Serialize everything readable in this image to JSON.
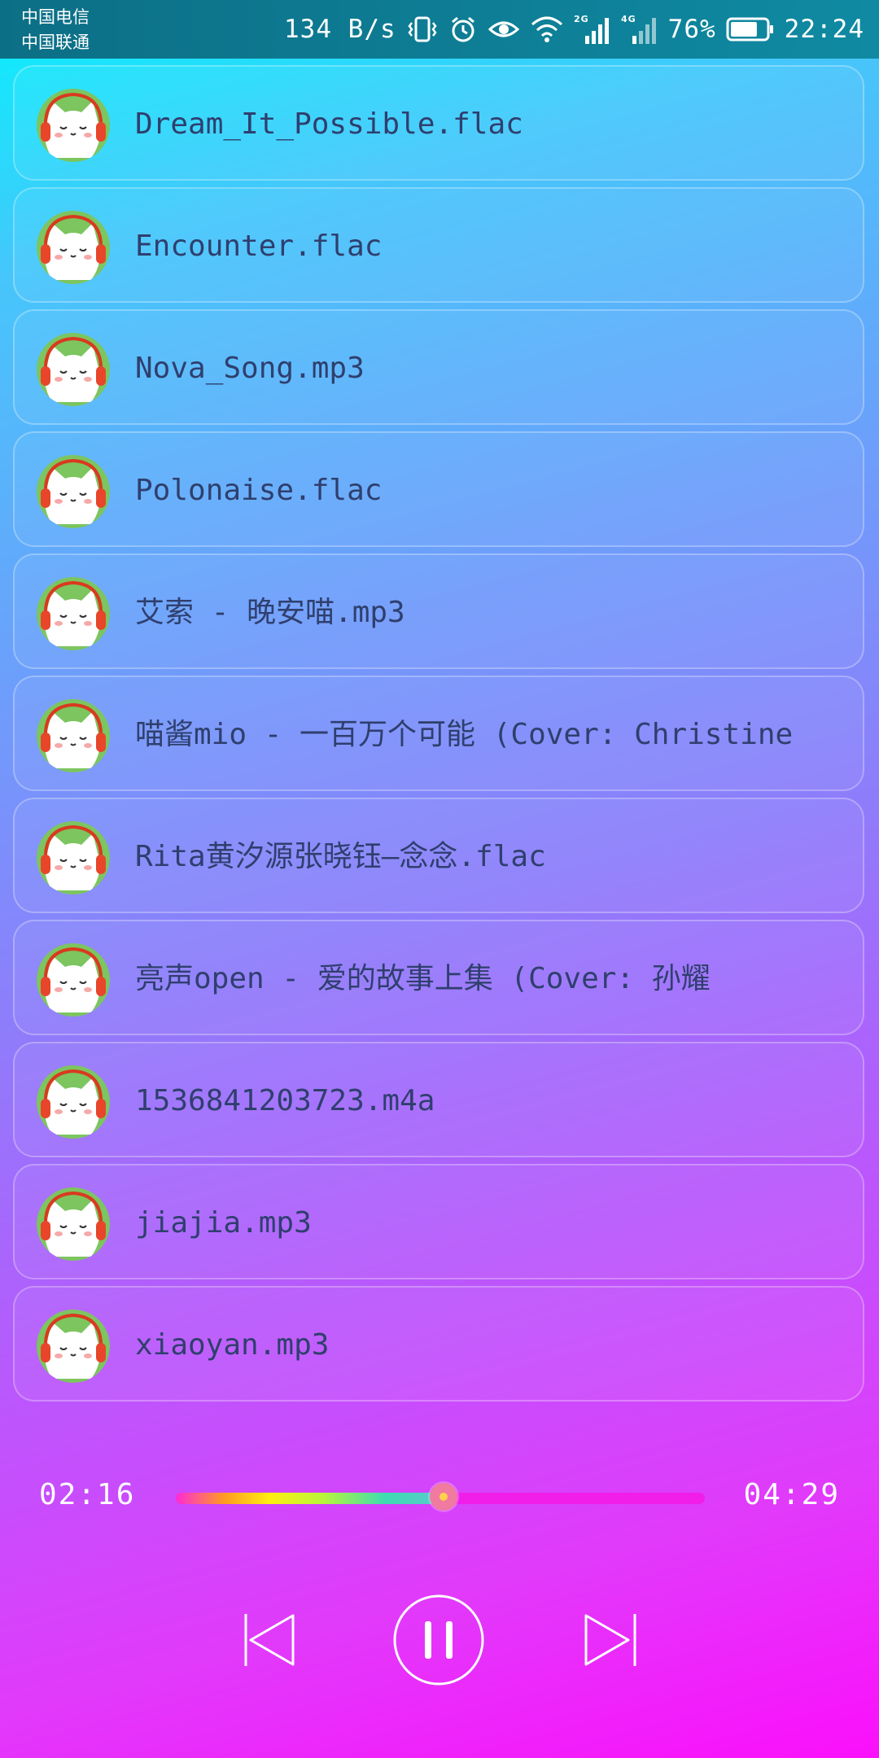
{
  "status_bar": {
    "carrier_1": "中国电信",
    "carrier_2": "中国联通",
    "net_speed": "134 B/s",
    "signal_1_label": "2G",
    "signal_2_label": "4G",
    "battery_percent": "76%",
    "battery_level": 0.76,
    "time": "22:24",
    "icons": [
      "vibrate-icon",
      "alarm-icon",
      "eye-icon",
      "wifi-icon",
      "signal-icon",
      "battery-icon"
    ]
  },
  "songs": [
    {
      "title": "Dream_It_Possible.flac"
    },
    {
      "title": "Encounter.flac"
    },
    {
      "title": "Nova_Song.mp3"
    },
    {
      "title": "Polonaise.flac"
    },
    {
      "title": "艾索 - 晚安喵.mp3"
    },
    {
      "title": "喵酱mio - 一百万个可能 (Cover: Christine"
    },
    {
      "title": "Rita黄汐源张晓钰—念念.flac"
    },
    {
      "title": "亮声open - 爱的故事上集 (Cover: 孙耀"
    },
    {
      "title": "1536841203723.m4a"
    },
    {
      "title": "jiajia.mp3"
    },
    {
      "title": "xiaoyan.mp3"
    }
  ],
  "player": {
    "current_time": "02:16",
    "total_time": "04:29",
    "progress": 0.506,
    "state": "playing",
    "controls": [
      "previous",
      "pause",
      "next"
    ]
  },
  "colors": {
    "background_top": "#06f1fb",
    "background_bottom": "#fb0ffb",
    "title_text": "#2f3f6e",
    "progress_track": "#f01ee8",
    "thumb": "#f07aa0"
  }
}
